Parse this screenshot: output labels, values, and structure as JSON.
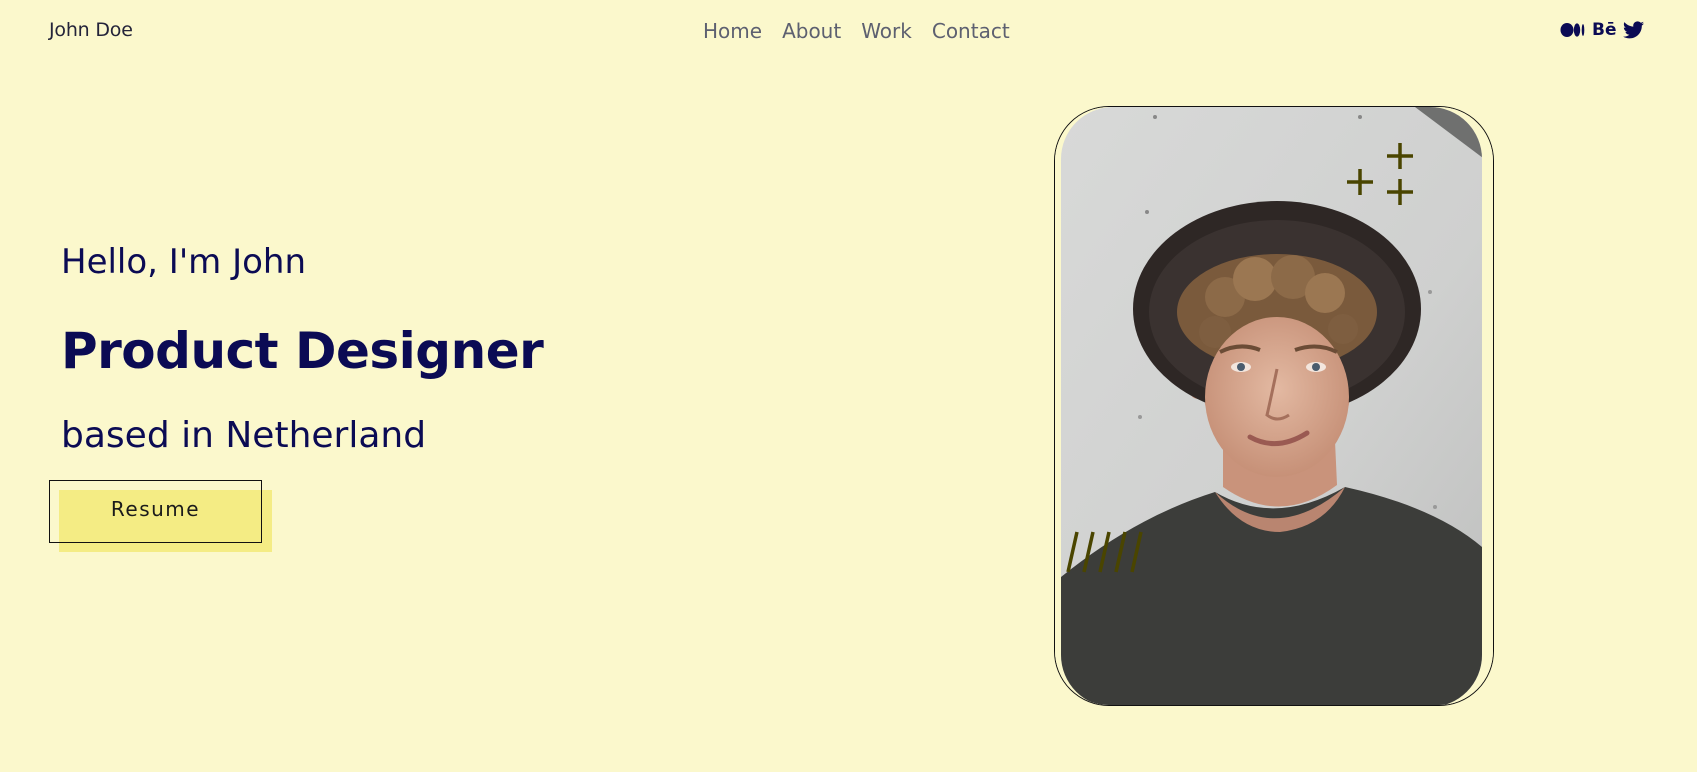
{
  "brand": "John Doe",
  "nav": {
    "items": [
      {
        "label": "Home"
      },
      {
        "label": "About"
      },
      {
        "label": "Work"
      },
      {
        "label": "Contact"
      }
    ]
  },
  "socials": {
    "behance_label": "Bē",
    "icons": [
      "medium-icon",
      "behance-icon",
      "twitter-icon"
    ]
  },
  "hero": {
    "greeting": "Hello, I'm John",
    "role": "Product Designer",
    "location": "based in Netherland",
    "resume_label": "Resume"
  },
  "colors": {
    "background": "#fbf8cc",
    "primary_text": "#0b0b54",
    "accent": "#f4ec84",
    "decoration": "#4a4500"
  },
  "photo": {
    "decorations": [
      "plus-marks",
      "slash-marks"
    ]
  }
}
